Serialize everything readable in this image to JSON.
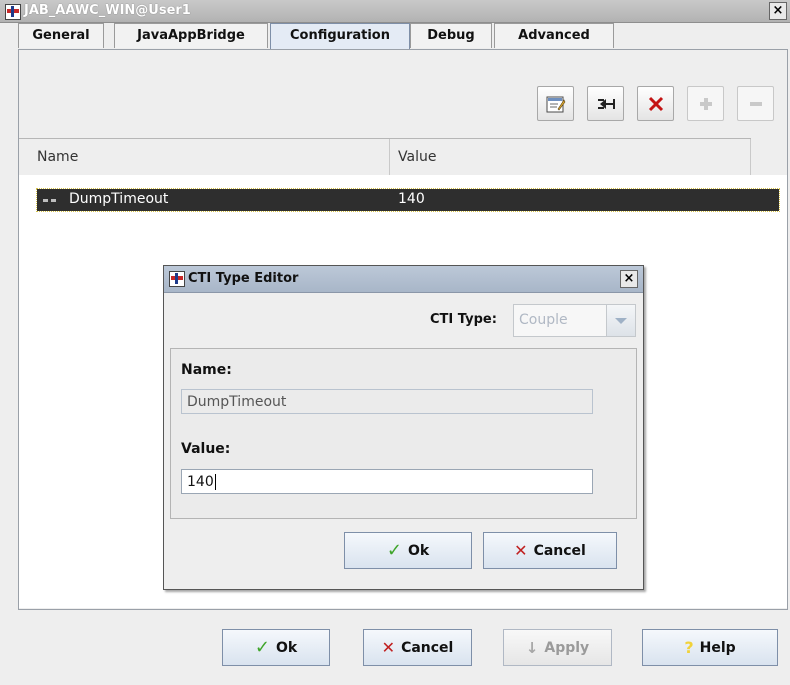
{
  "window": {
    "title": "JAB_AAWC_WIN@User1",
    "close_glyph": "×"
  },
  "tabs": [
    {
      "label": "General"
    },
    {
      "label": "JavaAppBridge"
    },
    {
      "label": "Configuration",
      "active": true
    },
    {
      "label": "Debug"
    },
    {
      "label": "Advanced"
    }
  ],
  "toolbar": {
    "icons": [
      "edit-properties-icon",
      "import-icon",
      "delete-icon",
      "add-icon",
      "remove-icon"
    ]
  },
  "table": {
    "columns": [
      "Name",
      "Value"
    ],
    "rows": [
      {
        "name": "DumpTimeout",
        "value": "140",
        "selected": true
      }
    ]
  },
  "dialog": {
    "title": "CTI Type Editor",
    "close_glyph": "×",
    "cti_type_label": "CTI Type:",
    "cti_type_value": "Couple",
    "name_label": "Name:",
    "name_value": "DumpTimeout",
    "value_label": "Value:",
    "value_value": "140",
    "ok_label": "Ok",
    "cancel_label": "Cancel"
  },
  "footer": {
    "ok_label": "Ok",
    "cancel_label": "Cancel",
    "apply_label": "Apply",
    "help_label": "Help"
  },
  "colors": {
    "selection_background": "#2e2e2e",
    "ok_check": "#3fa52a",
    "cancel_x": "#c02020",
    "help_question": "#f1d23a"
  }
}
